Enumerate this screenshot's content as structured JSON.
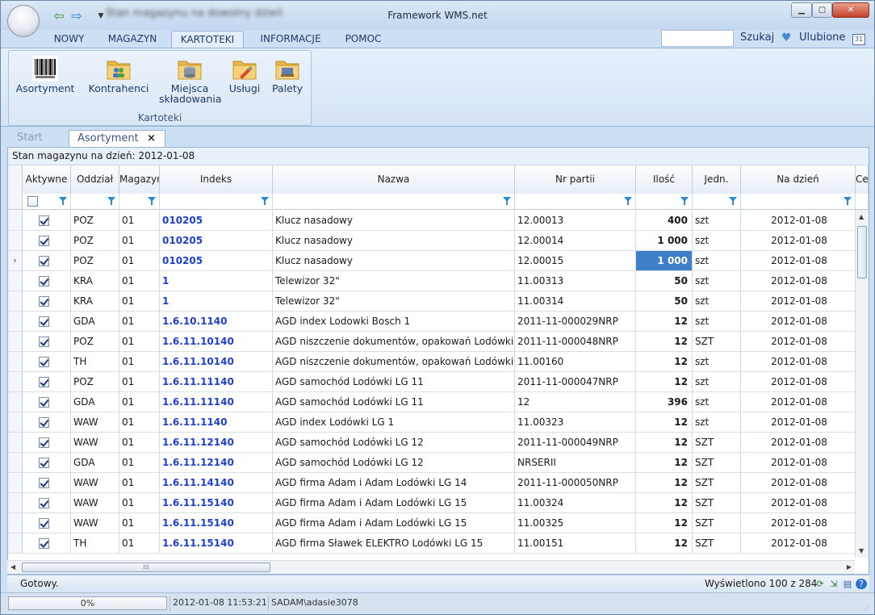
{
  "window": {
    "title": "Framework WMS.net",
    "blurred_caption": "Stan magazynu na dowolny dzień"
  },
  "menu": {
    "tabs": [
      "NOWY",
      "MAGAZYN",
      "KARTOTEKI",
      "INFORMACJE",
      "POMOC"
    ],
    "active": "KARTOTEKI",
    "search_label": "Szukaj",
    "favorites_label": "Ulubione"
  },
  "ribbon": {
    "group_label": "Kartoteki",
    "buttons": [
      {
        "label": "Asortyment",
        "icon": "barcode-icon"
      },
      {
        "label": "Kontrahenci",
        "icon": "contacts-folder-icon"
      },
      {
        "label": "Miejsca składowania",
        "icon": "storage-folder-icon"
      },
      {
        "label": "Usługi",
        "icon": "services-folder-icon"
      },
      {
        "label": "Palety",
        "icon": "pallets-folder-icon"
      }
    ]
  },
  "doc_tabs": {
    "start": "Start",
    "active": "Asortyment"
  },
  "grid": {
    "caption": "Stan magazynu na dzień: 2012-01-08",
    "columns": [
      "Aktywne",
      "Oddział",
      "Magazyn",
      "Indeks",
      "Nazwa",
      "Nr partii",
      "Ilość",
      "Jedn.",
      "Na dzień",
      "Cena"
    ],
    "column_visible_labels": [
      "Aktywne",
      "Oddział",
      "Magazyn",
      "Indeks",
      "Nazwa",
      "Nr partii",
      "Ilość",
      "Jedn.",
      "Na dzień",
      "Ce"
    ],
    "current_row": 2,
    "rows": [
      {
        "active": true,
        "oddzial": "POZ",
        "magazyn": "01",
        "indeks": "010205",
        "nazwa": "Klucz nasadowy",
        "partia": "12.00013",
        "ilosc": "400",
        "jedn": "szt",
        "dzien": "2012-01-08"
      },
      {
        "active": true,
        "oddzial": "POZ",
        "magazyn": "01",
        "indeks": "010205",
        "nazwa": "Klucz nasadowy",
        "partia": "12.00014",
        "ilosc": "1 000",
        "jedn": "szt",
        "dzien": "2012-01-08"
      },
      {
        "active": true,
        "oddzial": "POZ",
        "magazyn": "01",
        "indeks": "010205",
        "nazwa": "Klucz nasadowy",
        "partia": "12.00015",
        "ilosc": "1 000",
        "jedn": "szt",
        "dzien": "2012-01-08"
      },
      {
        "active": true,
        "oddzial": "KRA",
        "magazyn": "01",
        "indeks": "1",
        "nazwa": "Telewizor 32\"",
        "partia": "11.00313",
        "ilosc": "50",
        "jedn": "szt",
        "dzien": "2012-01-08"
      },
      {
        "active": true,
        "oddzial": "KRA",
        "magazyn": "01",
        "indeks": "1",
        "nazwa": "Telewizor 32\"",
        "partia": "11.00314",
        "ilosc": "50",
        "jedn": "szt",
        "dzien": "2012-01-08"
      },
      {
        "active": true,
        "oddzial": "GDA",
        "magazyn": "01",
        "indeks": "1.6.10.1140",
        "nazwa": "AGD index Lodowki Bosch 1",
        "partia": "2011-11-000029NRP",
        "ilosc": "12",
        "jedn": "szt",
        "dzien": "2012-01-08"
      },
      {
        "active": true,
        "oddzial": "POZ",
        "magazyn": "01",
        "indeks": "1.6.11.10140",
        "nazwa": "AGD niszczenie dokumentów, opakowań Lodówki LG",
        "partia": "2011-11-000048NRP",
        "ilosc": "12",
        "jedn": "SZT",
        "dzien": "2012-01-08"
      },
      {
        "active": true,
        "oddzial": "TH",
        "magazyn": "01",
        "indeks": "1.6.11.10140",
        "nazwa": "AGD niszczenie dokumentów, opakowań Lodówki ...",
        "partia": "11.00160",
        "ilosc": "12",
        "jedn": "szt",
        "dzien": "2012-01-08"
      },
      {
        "active": true,
        "oddzial": "POZ",
        "magazyn": "01",
        "indeks": "1.6.11.11140",
        "nazwa": "AGD samochód Lodówki LG 11",
        "partia": "2011-11-000047NRP",
        "ilosc": "12",
        "jedn": "szt",
        "dzien": "2012-01-08"
      },
      {
        "active": true,
        "oddzial": "GDA",
        "magazyn": "01",
        "indeks": "1.6.11.11140",
        "nazwa": "AGD samochód Lodówki LG 11",
        "partia": "12",
        "ilosc": "396",
        "jedn": "szt",
        "dzien": "2012-01-08"
      },
      {
        "active": true,
        "oddzial": "WAW",
        "magazyn": "01",
        "indeks": "1.6.11.1140",
        "nazwa": "AGD index Lodówki LG 1",
        "partia": "11.00323",
        "ilosc": "12",
        "jedn": "szt",
        "dzien": "2012-01-08"
      },
      {
        "active": true,
        "oddzial": "WAW",
        "magazyn": "01",
        "indeks": "1.6.11.12140",
        "nazwa": "AGD samochód Lodówki LG 12",
        "partia": "2011-11-000049NRP",
        "ilosc": "12",
        "jedn": "SZT",
        "dzien": "2012-01-08"
      },
      {
        "active": true,
        "oddzial": "GDA",
        "magazyn": "01",
        "indeks": "1.6.11.12140",
        "nazwa": "AGD samochód Lodówki LG 12",
        "partia": "NRSERII",
        "ilosc": "12",
        "jedn": "SZT",
        "dzien": "2012-01-08"
      },
      {
        "active": true,
        "oddzial": "WAW",
        "magazyn": "01",
        "indeks": "1.6.11.14140",
        "nazwa": "AGD firma Adam i Adam Lodówki LG 14",
        "partia": "2011-11-000050NRP",
        "ilosc": "12",
        "jedn": "SZT",
        "dzien": "2012-01-08"
      },
      {
        "active": true,
        "oddzial": "WAW",
        "magazyn": "01",
        "indeks": "1.6.11.15140",
        "nazwa": "AGD firma Adam i Adam Lodówki LG 15",
        "partia": "11.00324",
        "ilosc": "12",
        "jedn": "SZT",
        "dzien": "2012-01-08"
      },
      {
        "active": true,
        "oddzial": "WAW",
        "magazyn": "01",
        "indeks": "1.6.11.15140",
        "nazwa": "AGD firma Adam i Adam Lodówki LG 15",
        "partia": "11.00325",
        "ilosc": "12",
        "jedn": "SZT",
        "dzien": "2012-01-08"
      },
      {
        "active": true,
        "oddzial": "TH",
        "magazyn": "01",
        "indeks": "1.6.11.15140",
        "nazwa": "AGD firma Sławek ELEKTRO Lodówki LG 15",
        "partia": "11.00151",
        "ilosc": "12",
        "jedn": "SZT",
        "dzien": "2012-01-08"
      }
    ]
  },
  "status": {
    "text": "Gotowy.",
    "shown": "Wyświetlono 100 z 284"
  },
  "bottom": {
    "progress": "0%",
    "progress_fraction": 0,
    "datetime": "2012-01-08 11:53:21",
    "user": "SADAM\\adasie3078"
  },
  "colors": {
    "index_link": "#1f3fd0",
    "selected_cell": "#3d7fc9",
    "filter_icon": "#2a8ad6"
  }
}
